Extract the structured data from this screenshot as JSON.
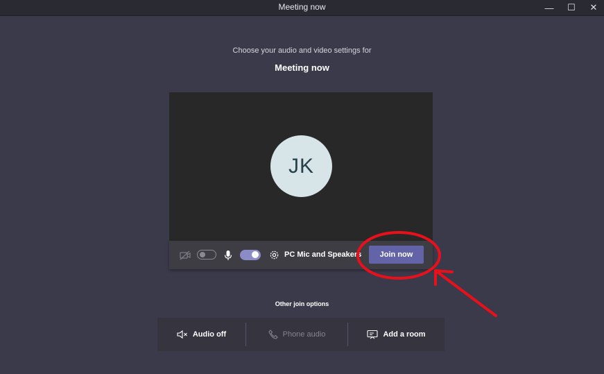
{
  "window": {
    "title": "Meeting now",
    "controls": {
      "minimize": "—",
      "maximize": "☐",
      "close": "✕"
    }
  },
  "prejoin": {
    "subtitle": "Choose your audio and video settings for",
    "meeting_title": "Meeting now",
    "avatar_initials": "JK",
    "camera_on": false,
    "mic_on": true,
    "device_label": "PC Mic and Speakers",
    "join_label": "Join now"
  },
  "other_options": {
    "heading": "Other join options",
    "items": [
      {
        "label": "Audio off",
        "icon": "speaker-off-icon",
        "enabled": true
      },
      {
        "label": "Phone audio",
        "icon": "phone-icon",
        "enabled": false
      },
      {
        "label": "Add a room",
        "icon": "cast-screen-icon",
        "enabled": true
      }
    ]
  },
  "colors": {
    "background": "#3b3a4b",
    "accent": "#6264a7",
    "toggle_on": "#8b8cc7",
    "annotation": "#e8101a"
  }
}
